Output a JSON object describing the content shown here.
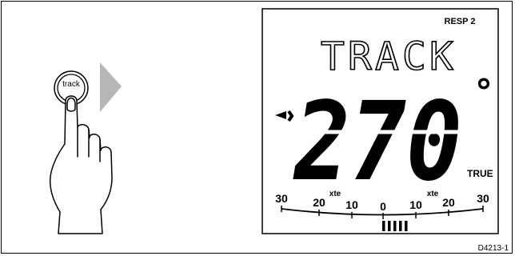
{
  "button": {
    "label": "track"
  },
  "display": {
    "response_label": "RESP 2",
    "mode": "TRACK",
    "heading_value": "270",
    "degree_symbol": "°",
    "reference": "TRUE",
    "xte_scale": {
      "left_ticks": [
        "30",
        "20",
        "10"
      ],
      "center_tick": "0",
      "right_ticks": [
        "10",
        "20",
        "30"
      ],
      "xte_label": "xte"
    },
    "cross_track_bar_segments": 5
  },
  "figure_ref": "D4213-1",
  "colors": {
    "ink": "#000000",
    "arrow": "#b7b7b7",
    "background": "#ffffff"
  }
}
